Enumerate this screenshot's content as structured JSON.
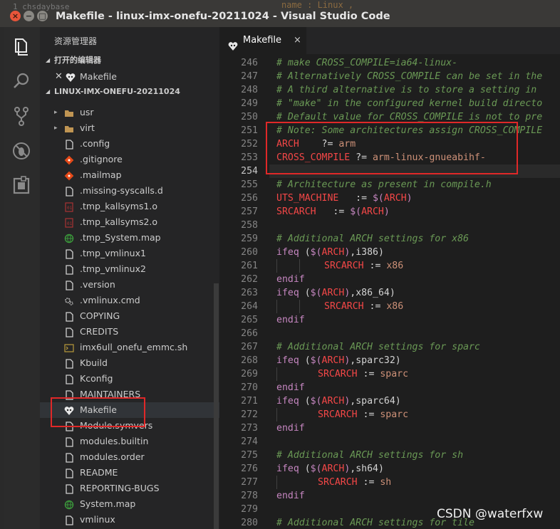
{
  "window": {
    "title": "Makefile - linux-imx-onefu-20211024 - Visual Studio Code",
    "ghost_text_left": "1 chsdaybase",
    "ghost_text_right": "name : Linux ,"
  },
  "sidebar": {
    "title": "资源管理器",
    "open_editors_label": "打开的编辑器",
    "open_file": "Makefile",
    "project_label": "LINUX-IMX-ONEFU-20211024",
    "items": [
      {
        "name": "usr",
        "type": "folder"
      },
      {
        "name": "virt",
        "type": "folder"
      },
      {
        "name": ".config",
        "type": "file"
      },
      {
        "name": ".gitignore",
        "type": "git"
      },
      {
        "name": ".mailmap",
        "type": "git"
      },
      {
        "name": ".missing-syscalls.d",
        "type": "file"
      },
      {
        "name": ".tmp_kallsyms1.o",
        "type": "binary"
      },
      {
        "name": ".tmp_kallsyms2.o",
        "type": "binary"
      },
      {
        "name": ".tmp_System.map",
        "type": "globe"
      },
      {
        "name": ".tmp_vmlinux1",
        "type": "file"
      },
      {
        "name": ".tmp_vmlinux2",
        "type": "file"
      },
      {
        "name": ".version",
        "type": "file"
      },
      {
        "name": ".vmlinux.cmd",
        "type": "gear"
      },
      {
        "name": "COPYING",
        "type": "file"
      },
      {
        "name": "CREDITS",
        "type": "file"
      },
      {
        "name": "imx6ull_onefu_emmc.sh",
        "type": "shell"
      },
      {
        "name": "Kbuild",
        "type": "file"
      },
      {
        "name": "Kconfig",
        "type": "file"
      },
      {
        "name": "MAINTAINERS",
        "type": "file"
      },
      {
        "name": "Makefile",
        "type": "makefile"
      },
      {
        "name": "Module.symvers",
        "type": "file"
      },
      {
        "name": "modules.builtin",
        "type": "file"
      },
      {
        "name": "modules.order",
        "type": "file"
      },
      {
        "name": "README",
        "type": "file"
      },
      {
        "name": "REPORTING-BUGS",
        "type": "file"
      },
      {
        "name": "System.map",
        "type": "globe"
      },
      {
        "name": "vmlinux",
        "type": "file"
      }
    ]
  },
  "editor": {
    "tab_label": "Makefile",
    "tab_close": "×",
    "current_line": 254,
    "lines": [
      {
        "n": 246,
        "tokens": [
          {
            "c": "cm",
            "t": "# make CROSS_COMPILE=ia64-linux-"
          }
        ]
      },
      {
        "n": 247,
        "tokens": [
          {
            "c": "cm",
            "t": "# Alternatively CROSS_COMPILE can be set in the"
          }
        ]
      },
      {
        "n": 248,
        "tokens": [
          {
            "c": "cm",
            "t": "# A third alternative is to store a setting in"
          }
        ]
      },
      {
        "n": 249,
        "tokens": [
          {
            "c": "cm",
            "t": "# \"make\" in the configured kernel build directo"
          }
        ]
      },
      {
        "n": 250,
        "tokens": [
          {
            "c": "cm",
            "t": "# Default value for CROSS_COMPILE is not to pre"
          }
        ]
      },
      {
        "n": 251,
        "tokens": [
          {
            "c": "cm",
            "t": "# Note: Some architectures assign CROSS_COMPILE"
          }
        ]
      },
      {
        "n": 252,
        "tokens": [
          {
            "c": "ky",
            "t": "ARCH"
          },
          {
            "c": "op",
            "t": "    ?= "
          },
          {
            "c": "vl",
            "t": "arm"
          }
        ]
      },
      {
        "n": 253,
        "tokens": [
          {
            "c": "ky",
            "t": "CROSS_COMPILE"
          },
          {
            "c": "op",
            "t": " ?= "
          },
          {
            "c": "vl",
            "t": "arm-linux-gnueabihf-"
          }
        ]
      },
      {
        "n": 254,
        "tokens": []
      },
      {
        "n": 255,
        "tokens": [
          {
            "c": "cm",
            "t": "# Architecture as present in compile.h"
          }
        ]
      },
      {
        "n": 256,
        "tokens": [
          {
            "c": "ky",
            "t": "UTS_MACHINE"
          },
          {
            "c": "op",
            "t": "   := "
          },
          {
            "c": "kw",
            "t": "$("
          },
          {
            "c": "ky",
            "t": "ARCH"
          },
          {
            "c": "kw",
            "t": ")"
          }
        ]
      },
      {
        "n": 257,
        "tokens": [
          {
            "c": "ky",
            "t": "SRCARCH"
          },
          {
            "c": "op",
            "t": "   := "
          },
          {
            "c": "kw",
            "t": "$("
          },
          {
            "c": "ky",
            "t": "ARCH"
          },
          {
            "c": "kw",
            "t": ")"
          }
        ]
      },
      {
        "n": 258,
        "tokens": []
      },
      {
        "n": 259,
        "tokens": [
          {
            "c": "cm",
            "t": "# Additional ARCH settings for x86"
          }
        ]
      },
      {
        "n": 260,
        "tokens": [
          {
            "c": "kw",
            "t": "ifeq"
          },
          {
            "c": "op",
            "t": " ("
          },
          {
            "c": "kw",
            "t": "$("
          },
          {
            "c": "ky",
            "t": "ARCH"
          },
          {
            "c": "kw",
            "t": ")"
          },
          {
            "c": "op",
            "t": ",i386)"
          }
        ]
      },
      {
        "n": 261,
        "indent": 2,
        "tokens": [
          {
            "c": "ky",
            "t": "SRCARCH"
          },
          {
            "c": "op",
            "t": " := "
          },
          {
            "c": "vl",
            "t": "x86"
          }
        ]
      },
      {
        "n": 262,
        "tokens": [
          {
            "c": "kw",
            "t": "endif"
          }
        ]
      },
      {
        "n": 263,
        "tokens": [
          {
            "c": "kw",
            "t": "ifeq"
          },
          {
            "c": "op",
            "t": " ("
          },
          {
            "c": "kw",
            "t": "$("
          },
          {
            "c": "ky",
            "t": "ARCH"
          },
          {
            "c": "kw",
            "t": ")"
          },
          {
            "c": "op",
            "t": ",x86_64)"
          }
        ]
      },
      {
        "n": 264,
        "indent": 2,
        "tokens": [
          {
            "c": "ky",
            "t": "SRCARCH"
          },
          {
            "c": "op",
            "t": " := "
          },
          {
            "c": "vl",
            "t": "x86"
          }
        ]
      },
      {
        "n": 265,
        "tokens": [
          {
            "c": "kw",
            "t": "endif"
          }
        ]
      },
      {
        "n": 266,
        "tokens": []
      },
      {
        "n": 267,
        "tokens": [
          {
            "c": "cm",
            "t": "# Additional ARCH settings for sparc"
          }
        ]
      },
      {
        "n": 268,
        "tokens": [
          {
            "c": "kw",
            "t": "ifeq"
          },
          {
            "c": "op",
            "t": " ("
          },
          {
            "c": "kw",
            "t": "$("
          },
          {
            "c": "ky",
            "t": "ARCH"
          },
          {
            "c": "kw",
            "t": ")"
          },
          {
            "c": "op",
            "t": ",sparc32)"
          }
        ]
      },
      {
        "n": 269,
        "indent": 1,
        "tokens": [
          {
            "c": "ky",
            "t": "SRCARCH"
          },
          {
            "c": "op",
            "t": " := "
          },
          {
            "c": "vl",
            "t": "sparc"
          }
        ]
      },
      {
        "n": 270,
        "tokens": [
          {
            "c": "kw",
            "t": "endif"
          }
        ]
      },
      {
        "n": 271,
        "tokens": [
          {
            "c": "kw",
            "t": "ifeq"
          },
          {
            "c": "op",
            "t": " ("
          },
          {
            "c": "kw",
            "t": "$("
          },
          {
            "c": "ky",
            "t": "ARCH"
          },
          {
            "c": "kw",
            "t": ")"
          },
          {
            "c": "op",
            "t": ",sparc64)"
          }
        ]
      },
      {
        "n": 272,
        "indent": 1,
        "tokens": [
          {
            "c": "ky",
            "t": "SRCARCH"
          },
          {
            "c": "op",
            "t": " := "
          },
          {
            "c": "vl",
            "t": "sparc"
          }
        ]
      },
      {
        "n": 273,
        "tokens": [
          {
            "c": "kw",
            "t": "endif"
          }
        ]
      },
      {
        "n": 274,
        "tokens": []
      },
      {
        "n": 275,
        "tokens": [
          {
            "c": "cm",
            "t": "# Additional ARCH settings for sh"
          }
        ]
      },
      {
        "n": 276,
        "tokens": [
          {
            "c": "kw",
            "t": "ifeq"
          },
          {
            "c": "op",
            "t": " ("
          },
          {
            "c": "kw",
            "t": "$("
          },
          {
            "c": "ky",
            "t": "ARCH"
          },
          {
            "c": "kw",
            "t": ")"
          },
          {
            "c": "op",
            "t": ",sh64)"
          }
        ]
      },
      {
        "n": 277,
        "indent": 1,
        "tokens": [
          {
            "c": "ky",
            "t": "SRCARCH"
          },
          {
            "c": "op",
            "t": " := "
          },
          {
            "c": "vl",
            "t": "sh"
          }
        ]
      },
      {
        "n": 278,
        "tokens": [
          {
            "c": "kw",
            "t": "endif"
          }
        ]
      },
      {
        "n": 279,
        "tokens": []
      },
      {
        "n": 280,
        "tokens": [
          {
            "c": "cm",
            "t": "# Additional ARCH settings for tile"
          }
        ]
      }
    ]
  },
  "watermark": "CSDN @waterfxw",
  "colors": {
    "highlight_box": "#e02828",
    "comment": "#6a9955",
    "keyword": "#c586c0",
    "variable": "#f44747",
    "value": "#ce9178"
  }
}
